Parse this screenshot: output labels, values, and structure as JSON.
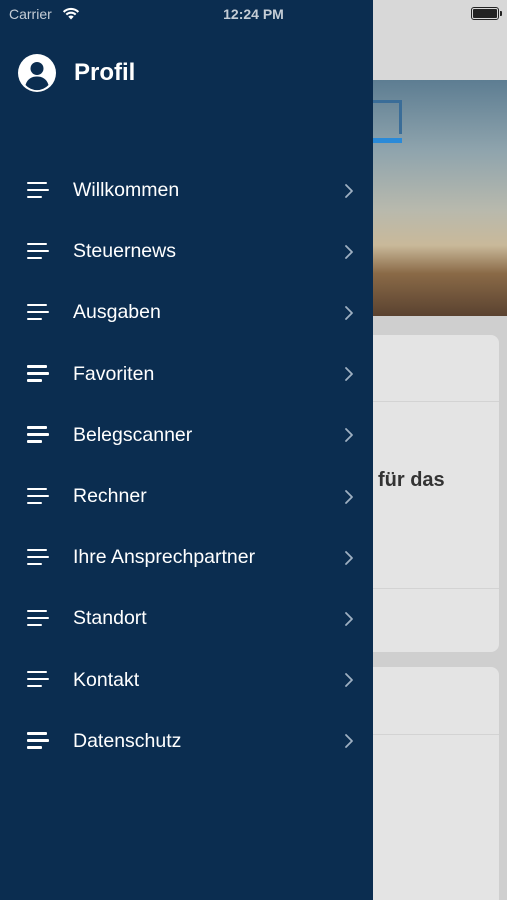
{
  "status_bar": {
    "carrier": "Carrier",
    "time": "12:24 PM"
  },
  "drawer": {
    "profile_label": "Profil",
    "items": [
      {
        "label": "Willkommen",
        "icon": "list-icon"
      },
      {
        "label": "Steuernews",
        "icon": "list-icon"
      },
      {
        "label": "Ausgaben",
        "icon": "list-icon"
      },
      {
        "label": "Favoriten",
        "icon": "list-icon"
      },
      {
        "label": "Belegscanner",
        "icon": "list-icon"
      },
      {
        "label": "Rechner",
        "icon": "list-icon"
      },
      {
        "label": "Ihre Ansprechpartner",
        "icon": "list-icon"
      },
      {
        "label": "Standort",
        "icon": "list-icon"
      },
      {
        "label": "Kontakt",
        "icon": "list-icon"
      },
      {
        "label": "Datenschutz",
        "icon": "list-icon"
      }
    ]
  },
  "background": {
    "card_text": "für das"
  },
  "colors": {
    "drawer_bg": "#0b2d50",
    "text": "#ffffff"
  }
}
